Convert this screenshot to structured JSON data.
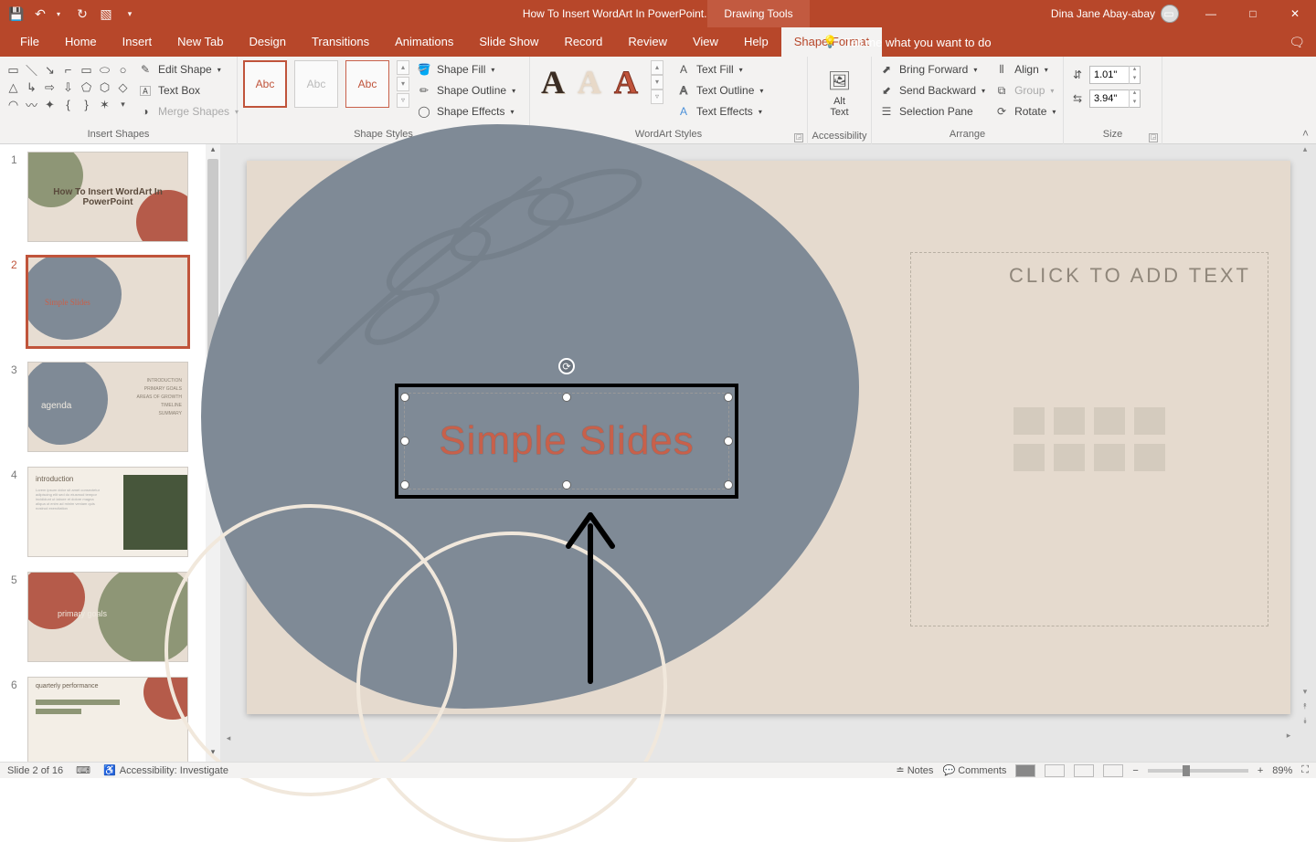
{
  "titlebar": {
    "doc_title": "How To Insert WordArt In PowerPoint.pptx  -  PowerPoint",
    "context_tab": "Drawing Tools",
    "user_name": "Dina Jane Abay-abay"
  },
  "tabs": {
    "file": "File",
    "home": "Home",
    "insert": "Insert",
    "newtab": "New Tab",
    "design": "Design",
    "transitions": "Transitions",
    "animations": "Animations",
    "slideshow": "Slide Show",
    "record": "Record",
    "review": "Review",
    "view": "View",
    "help": "Help",
    "shapeformat": "Shape Format",
    "tellme": "Tell me what you want to do"
  },
  "ribbon": {
    "insert_shapes": {
      "label": "Insert Shapes",
      "edit_shape": "Edit Shape",
      "text_box": "Text Box",
      "merge_shapes": "Merge Shapes"
    },
    "shape_styles": {
      "label": "Shape Styles",
      "abc": "Abc",
      "shape_fill": "Shape Fill",
      "shape_outline": "Shape Outline",
      "shape_effects": "Shape Effects"
    },
    "wordart_styles": {
      "label": "WordArt Styles",
      "text_fill": "Text Fill",
      "text_outline": "Text Outline",
      "text_effects": "Text Effects"
    },
    "accessibility": {
      "label": "Accessibility",
      "alt_text": "Alt\nText"
    },
    "arrange": {
      "label": "Arrange",
      "bring_forward": "Bring Forward",
      "send_backward": "Send Backward",
      "selection_pane": "Selection Pane",
      "align": "Align",
      "group": "Group",
      "rotate": "Rotate"
    },
    "size": {
      "label": "Size",
      "height": "1.01\"",
      "width": "3.94\""
    }
  },
  "thumbnails": [
    {
      "n": "1",
      "title": "How To Insert WordArt In PowerPoint"
    },
    {
      "n": "2",
      "title": "Simple Slides"
    },
    {
      "n": "3",
      "title": "agenda",
      "lines": [
        "INTRODUCTION",
        "PRIMARY GOALS",
        "AREAS OF GROWTH",
        "TIMELINE",
        "SUMMARY"
      ]
    },
    {
      "n": "4",
      "title": "introduction"
    },
    {
      "n": "5",
      "title": "primary goals"
    },
    {
      "n": "6",
      "title": "quarterly performance"
    }
  ],
  "slide": {
    "placeholder_text": "CLICK TO ADD TEXT",
    "wordart_text": "Simple Slides"
  },
  "statusbar": {
    "slide_info": "Slide 2 of 16",
    "accessibility": "Accessibility: Investigate",
    "notes": "Notes",
    "comments": "Comments",
    "zoom": "89%"
  }
}
